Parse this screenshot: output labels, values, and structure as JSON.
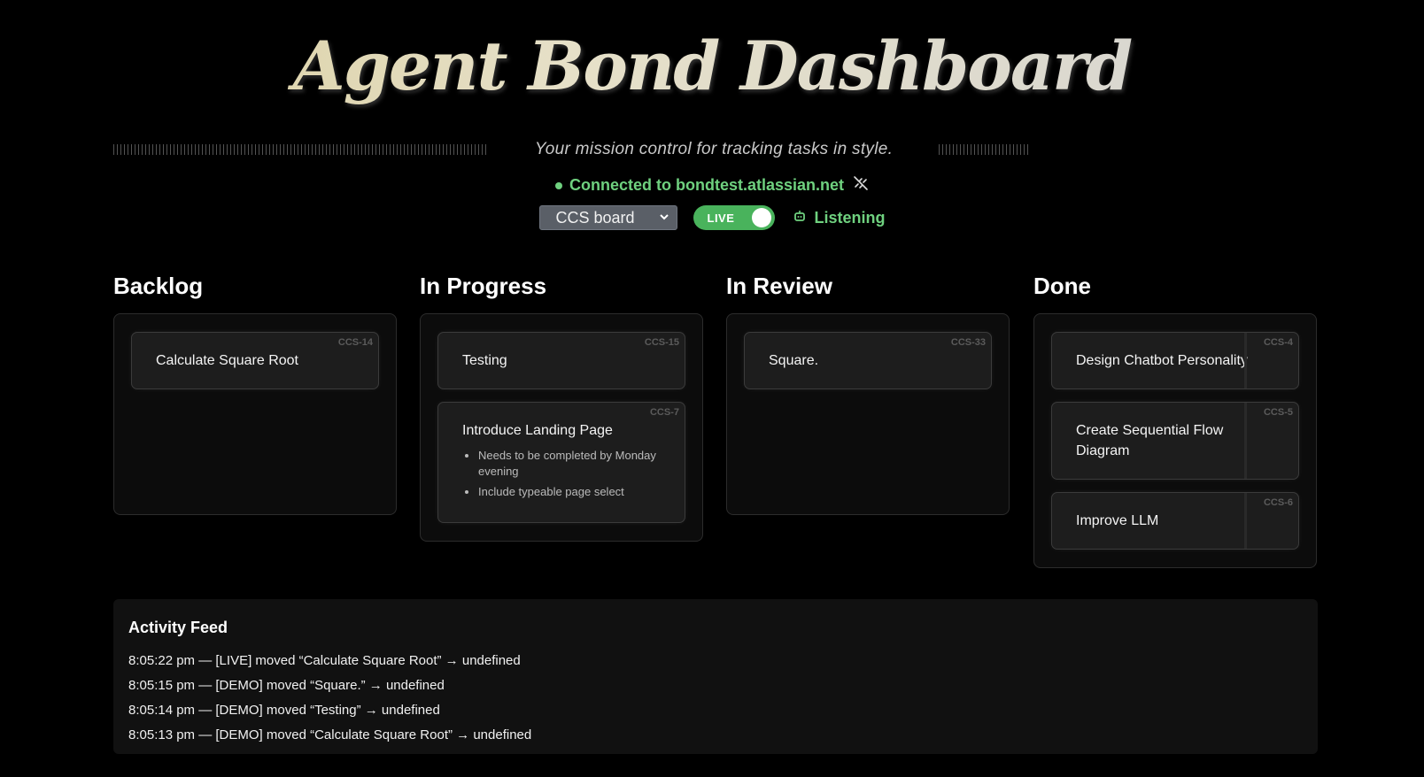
{
  "header": {
    "title": "Agent Bond Dashboard",
    "subtitle": "Your mission control for tracking tasks in style.",
    "status_text": "Connected to bondtest.atlassian.net"
  },
  "controls": {
    "board_select": "CCS board",
    "toggle_label": "LIVE",
    "listening_label": "Listening"
  },
  "columns": [
    {
      "title": "Backlog",
      "cards": [
        {
          "id": "CCS-14",
          "title": "Calculate Square Root"
        }
      ]
    },
    {
      "title": "In Progress",
      "cards": [
        {
          "id": "CCS-15",
          "title": "Testing"
        },
        {
          "id": "CCS-7",
          "title": "Introduce Landing Page",
          "notes": [
            "Needs to be completed by Monday evening",
            "Include typeable page select"
          ]
        }
      ]
    },
    {
      "title": "In Review",
      "cards": [
        {
          "id": "CCS-33",
          "title": "Square."
        }
      ]
    },
    {
      "title": "Done",
      "cards": [
        {
          "id": "CCS-4",
          "title": "Design Chatbot Personality"
        },
        {
          "id": "CCS-5",
          "title": "Create Sequential Flow Diagram"
        },
        {
          "id": "CCS-6",
          "title": "Improve LLM"
        }
      ]
    }
  ],
  "activity_feed": {
    "title": "Activity Feed",
    "items": [
      "8:05:22 pm — [LIVE] moved “Calculate Square Root” → undefined",
      "8:05:15 pm — [DEMO] moved “Square.” → undefined",
      "8:05:14 pm — [DEMO] moved “Testing” → undefined",
      "8:05:13 pm — [DEMO] moved “Calculate Square Root” → undefined"
    ]
  },
  "colors": {
    "background": "#000000",
    "accent_green": "#6fd17f",
    "toggle_green": "#49b35c",
    "card_bg": "#1d1d1d"
  },
  "icons": {
    "status": "green-dot-icon",
    "unlink": "unlink-icon",
    "listening": "robot-icon",
    "select": "chevron-down-icon"
  }
}
